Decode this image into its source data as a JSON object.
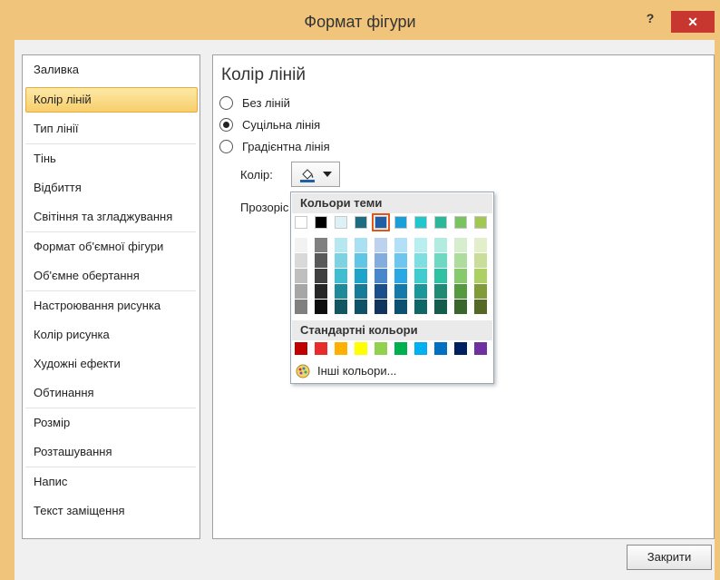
{
  "window": {
    "title": "Формат фігури",
    "help": "?",
    "close_glyph": "✕"
  },
  "nav": {
    "items": [
      "Заливка",
      "Колір ліній",
      "Тип лінії",
      "Тінь",
      "Відбиття",
      "Світіння та згладжування",
      "Формат об'ємної фігури",
      "Об'ємне обертання",
      "Настроювання рисунка",
      "Колір рисунка",
      "Художні ефекти",
      "Обтинання",
      "Розмір",
      "Розташування",
      "Напис",
      "Текст заміщення"
    ],
    "selected": "Колір ліній"
  },
  "panel": {
    "title": "Колір ліній",
    "radio_none": "Без ліній",
    "radio_solid": "Суцільна лінія",
    "radio_gradient": "Градієнтна лінія",
    "selected_radio": "Суцільна лінія",
    "color_label": "Колір:",
    "transparency_label": "Прозоріс"
  },
  "icons": {
    "color_button": "paint-bucket-icon",
    "dropdown": "chevron-down-icon",
    "more_colors": "palette-icon"
  },
  "colors": {
    "accent_title": "#f0c47a",
    "close_red": "#c7372f",
    "selected_outline": "#e0561d",
    "theme_top": [
      "#ffffff",
      "#000000",
      "#ddf2f6",
      "#1e6c7f",
      "#1f5fa6",
      "#1aa0d8",
      "#21c7cc",
      "#2ab79a",
      "#79c460",
      "#a2c753"
    ],
    "theme_shades": [
      [
        "#f2f2f2",
        "#d9d9d9",
        "#bfbfbf",
        "#a6a6a6",
        "#808080"
      ],
      [
        "#808080",
        "#595959",
        "#404040",
        "#262626",
        "#0d0d0d"
      ],
      [
        "#b7e7ef",
        "#7dd3e1",
        "#3fbed2",
        "#1f8a9a",
        "#115661"
      ],
      [
        "#a9e0f2",
        "#60c6e6",
        "#1ea3cb",
        "#167a99",
        "#0f5166"
      ],
      [
        "#bcd2ee",
        "#84add f",
        "#4a86cc",
        "#1a4f8c",
        "#11355d"
      ],
      [
        "#b2e1f7",
        "#6dc6ef",
        "#2aa8e3",
        "#137aaa",
        "#0c5171"
      ],
      [
        "#b8eef0",
        "#7ddfe2",
        "#3fccd1",
        "#19979b",
        "#106567"
      ],
      [
        "#b2ece0",
        "#6ed9c2",
        "#2fc2a2",
        "#1f8b74",
        "#145d4d"
      ],
      [
        "#d6edce",
        "#aedc9d",
        "#86ca6c",
        "#569a40",
        "#39672b"
      ],
      [
        "#e3eecb",
        "#c9de98",
        "#add064",
        "#7f9c39",
        "#556826"
      ]
    ],
    "standard": [
      "#c00000",
      "#e82c2c",
      "#ffb000",
      "#ffff00",
      "#92d050",
      "#00b050",
      "#00b0f0",
      "#0070c0",
      "#002060",
      "#7030a0"
    ]
  },
  "popup": {
    "theme_header": "Кольори теми",
    "standard_header": "Стандартні кольори",
    "more_colors": "Інші кольори...",
    "selected_theme_index": 4
  },
  "footer": {
    "close_button": "Закрити"
  }
}
